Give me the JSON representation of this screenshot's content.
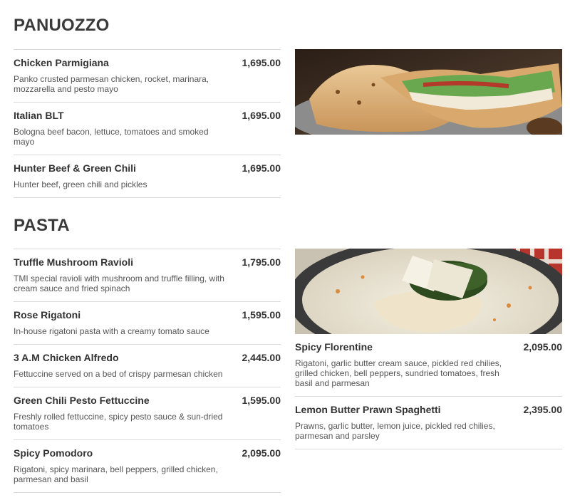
{
  "sections": [
    {
      "title": "PANUOZZO",
      "items": [
        {
          "name": "Chicken Parmigiana",
          "price": "1,695.00",
          "desc": "Panko crusted parmesan chicken, rocket, marinara, mozzarella and pesto mayo"
        },
        {
          "name": "Italian BLT",
          "price": "1,695.00",
          "desc": "Bologna beef bacon, lettuce, tomatoes and smoked mayo"
        },
        {
          "name": "Hunter Beef & Green Chili",
          "price": "1,695.00",
          "desc": "Hunter beef, green chili and pickles"
        }
      ]
    },
    {
      "title": "PASTA",
      "items": [
        {
          "name": "Truffle Mushroom Ravioli",
          "price": "1,795.00",
          "desc": "TMI special ravioli with mushroom and truffle filling, with cream sauce and fried spinach"
        },
        {
          "name": "Rose Rigatoni",
          "price": "1,595.00",
          "desc": "In-house rigatoni pasta with a creamy tomato sauce"
        },
        {
          "name": "3 A.M Chicken Alfredo",
          "price": "2,445.00",
          "desc": "Fettuccine served on a bed of crispy parmesan chicken"
        },
        {
          "name": "Green Chili Pesto Fettuccine",
          "price": "1,595.00",
          "desc": "Freshly rolled fettuccine, spicy pesto sauce & sun-dried tomatoes"
        },
        {
          "name": "Spicy Pomodoro",
          "price": "2,095.00",
          "desc": "Rigatoni, spicy marinara, bell peppers, grilled chicken, parmesan and basil"
        }
      ],
      "side_items": [
        {
          "name": "Spicy Florentine",
          "price": "2,095.00",
          "desc": "Rigatoni, garlic butter cream sauce, pickled red chilies, grilled chicken, bell peppers, sundried tomatoes, fresh basil and parmesan"
        },
        {
          "name": "Lemon Butter Prawn Spaghetti",
          "price": "2,395.00",
          "desc": "Prawns, garlic butter, lemon juice, pickled red chilies, parmesan and parsley"
        }
      ]
    }
  ],
  "images": {
    "panuozzo_photo": "panuozzo-sandwich-image",
    "pasta_photo": "ravioli-pasta-image"
  }
}
